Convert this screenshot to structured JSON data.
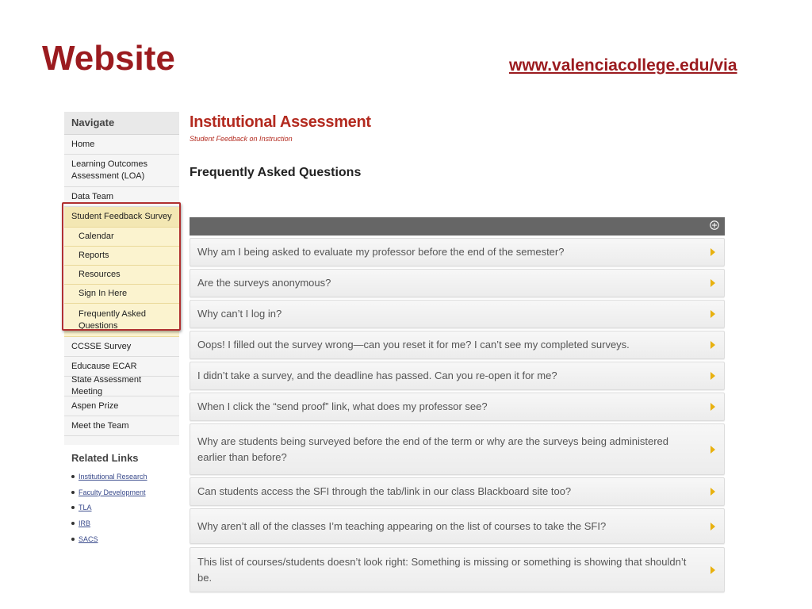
{
  "slide": {
    "title": "Website",
    "url": "www.valenciacollege.edu/via"
  },
  "sidebar": {
    "header": "Navigate",
    "items": [
      {
        "label": "Home"
      },
      {
        "label": "Learning Outcomes Assessment (LOA)"
      },
      {
        "label": "Data Team"
      },
      {
        "label": "Student Feedback Survey"
      },
      {
        "label": "Calendar"
      },
      {
        "label": "Reports"
      },
      {
        "label": "Resources"
      },
      {
        "label": "Sign In Here"
      },
      {
        "label": "Frequently Asked Questions"
      },
      {
        "label": "CCSSE Survey"
      },
      {
        "label": "Educause ECAR"
      },
      {
        "label": "State Assessment Meeting"
      },
      {
        "label": "Aspen Prize"
      },
      {
        "label": "Meet the Team"
      }
    ],
    "highlight_color": "#b03030"
  },
  "related": {
    "title": "Related Links",
    "links": [
      {
        "label": "Institutional Research"
      },
      {
        "label": "Faculty Development"
      },
      {
        "label": "TLA"
      },
      {
        "label": "IRB"
      },
      {
        "label": "SACS"
      }
    ]
  },
  "main": {
    "title": "Institutional Assessment",
    "subtitle": "Student Feedback on Instruction",
    "faq_heading": "Frequently Asked Questions",
    "expand_icon": "plus-circle-icon",
    "faqs": [
      {
        "question": "Why am I being asked to evaluate my professor before the end of the semester?"
      },
      {
        "question": "Are the surveys anonymous?"
      },
      {
        "question": "Why can’t I log in?"
      },
      {
        "question": "Oops! I filled out the survey wrong—can you reset it for me? I can’t see my completed surveys."
      },
      {
        "question": "I didn’t take a survey, and the deadline has passed. Can you re-open it for me?"
      },
      {
        "question": "When I click the “send proof” link, what does my professor see?"
      },
      {
        "question": "Why are students being surveyed before the end of the term or why are the surveys being administered earlier than before?"
      },
      {
        "question": "Can students access the SFI through the tab/link in our class Blackboard site too?"
      },
      {
        "question": "Why aren’t all of the classes I’m teaching appearing on the list of courses to take the SFI?"
      },
      {
        "question": "This list of courses/students doesn’t look right: Something is missing or something is showing that shouldn’t be."
      }
    ]
  },
  "colors": {
    "brand_red": "#9b1b1f",
    "accent_red": "#b32a1f",
    "arrow_yellow": "#e8b10f",
    "bar_gray": "#666666",
    "submenu_yellow": "#fbf3cf"
  }
}
